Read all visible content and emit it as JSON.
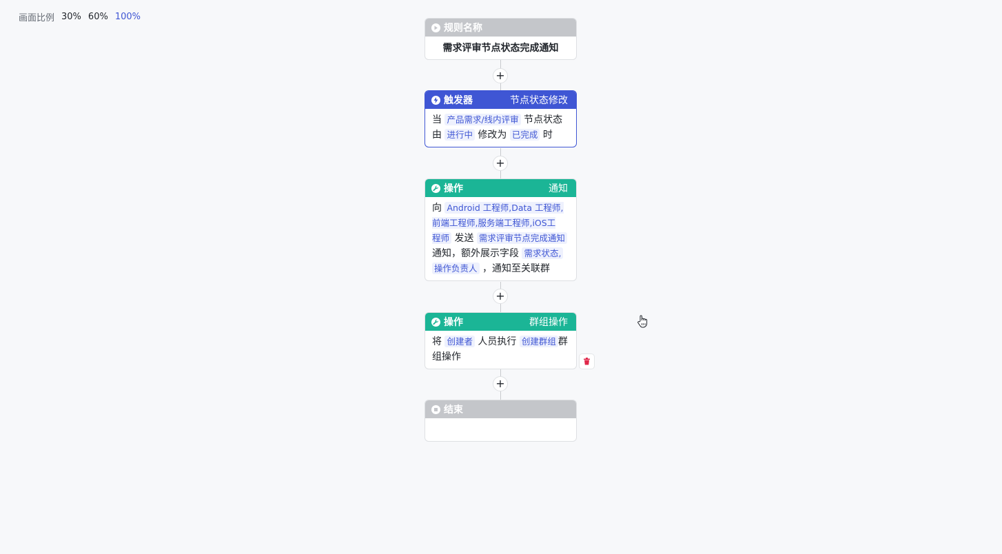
{
  "toolbar": {
    "label": "画面比例",
    "options": [
      "30%",
      "60%",
      "100%"
    ],
    "active": "100%"
  },
  "flow": {
    "start": {
      "header": "规则名称",
      "title": "需求评审节点状态完成通知"
    },
    "trigger": {
      "header": "触发器",
      "type": "节点状态修改",
      "parts": [
        "当",
        "产品需求/线内评审",
        "节点状态",
        "由",
        "进行中",
        "修改为",
        "已完成",
        "时"
      ]
    },
    "action1": {
      "header": "操作",
      "type": "通知",
      "parts": [
        "向",
        "Android 工程师,Data 工程师,",
        "前端工程师,服务端工程师,iOS工",
        "程师",
        "发送",
        "需求评审节点完成通知",
        "通知，额外展示字段",
        "需求状态,",
        "操作负责人",
        "，通知至关联群"
      ]
    },
    "action2": {
      "header": "操作",
      "type": "群组操作",
      "parts": [
        "将",
        "创建者",
        "人员执行",
        "创建群组",
        "群",
        "组操作"
      ]
    },
    "end": {
      "header": "结束"
    },
    "add_symbol": "+"
  },
  "colors": {
    "trigger": "#3f56d4",
    "action": "#1bb596",
    "neutral": "#c4c6ca",
    "tag_text": "#3f56d4",
    "tag_bg": "#eef1fd",
    "delete": "#e0284a"
  },
  "icons": {
    "start": "play-icon",
    "trigger": "bolt-icon",
    "action": "wrench-icon",
    "end": "stop-icon",
    "delete": "trash-icon",
    "cursor": "hand-pointer-icon"
  }
}
